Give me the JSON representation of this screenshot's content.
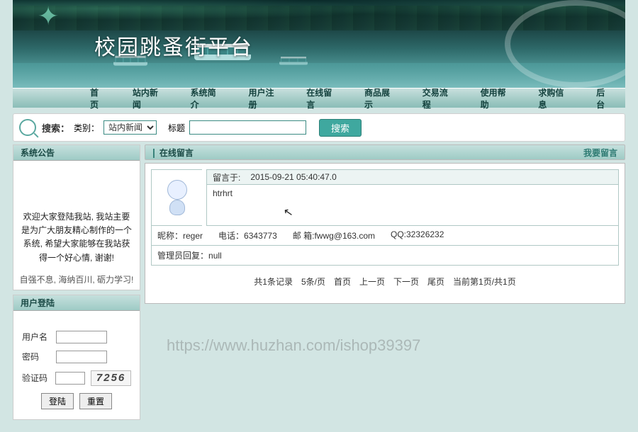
{
  "banner": {
    "title": "校园跳蚤街平台"
  },
  "nav": {
    "items": [
      "首页",
      "站内新闻",
      "系统简介",
      "用户注册",
      "在线留言",
      "商品展示",
      "交易流程",
      "使用帮助",
      "求购信息",
      "后台"
    ]
  },
  "search": {
    "label": "搜索：",
    "category_label": "类别：",
    "category_option": "站内新闻",
    "title_label": "标题",
    "button": "搜索"
  },
  "announcement": {
    "title": "系统公告",
    "body": "欢迎大家登陆我站, 我站主要是为广大朋友精心制作的一个系统, 希望大家能够在我站获得一个好心情, 谢谢!",
    "footer": "自强不息, 海纳百川, 砺力学习!"
  },
  "login": {
    "title": "用户登陆",
    "username_label": "用户名",
    "password_label": "密码",
    "captcha_label": "验证码",
    "captcha_value": "7256",
    "login_btn": "登陆",
    "reset_btn": "重置"
  },
  "messageboard": {
    "title": "在线留言",
    "write_link": "我要留言",
    "message": {
      "date_prefix": "留言于:",
      "date": "2015-09-21 05:40:47.0",
      "content": "htrhrt",
      "nickname_label": "昵称：",
      "nickname": "reger",
      "phone_label": "电话：",
      "phone": "6343773",
      "email_label": "邮  箱:",
      "email": "fwwg@163.com",
      "qq_label": "QQ:",
      "qq": "32326232",
      "reply_label": "管理员回复：",
      "reply": "null"
    },
    "pagination": {
      "total": "共1条记录",
      "per_page": "5条/页",
      "first": "首页",
      "prev": "上一页",
      "next": "下一页",
      "last": "尾页",
      "current": "当前第1页/共1页"
    }
  },
  "watermark": "https://www.huzhan.com/ishop39397"
}
